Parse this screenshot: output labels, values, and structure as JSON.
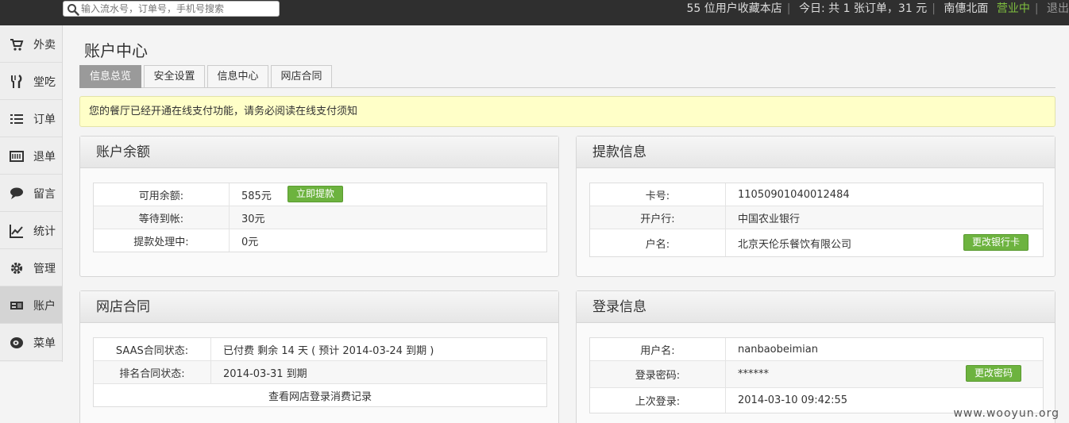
{
  "topbar": {
    "search_placeholder": "输入流水号，订单号，手机号搜索",
    "favorites": "55 位用户收藏本店",
    "today": "今日: 共 1 张订单，31 元",
    "shop_name": "南僡北面",
    "status": "营业中",
    "logout": "退出",
    "status_color": "#7fbf3f"
  },
  "sidebar": {
    "items": [
      {
        "label": "外卖",
        "icon": "cart-icon"
      },
      {
        "label": "堂吃",
        "icon": "fork-knife-icon"
      },
      {
        "label": "订单",
        "icon": "list-icon"
      },
      {
        "label": "退单",
        "icon": "return-icon"
      },
      {
        "label": "留言",
        "icon": "chat-bubble-icon"
      },
      {
        "label": "统计",
        "icon": "line-chart-icon"
      },
      {
        "label": "管理",
        "icon": "gear-icon"
      },
      {
        "label": "账户",
        "icon": "account-card-icon"
      },
      {
        "label": "菜单",
        "icon": "dish-icon"
      }
    ],
    "active_index": 7
  },
  "page": {
    "title": "账户中心",
    "tabs": [
      "信息总览",
      "安全设置",
      "信息中心",
      "网店合同"
    ],
    "active_tab": 0,
    "notice": "您的餐厅已经开通在线支付功能，请务必阅读在线支付须知"
  },
  "balance": {
    "title": "账户余额",
    "rows": [
      {
        "label": "可用余额:",
        "value": "585元"
      },
      {
        "label": "等待到帐:",
        "value": "30元"
      },
      {
        "label": "提款处理中:",
        "value": "0元"
      }
    ],
    "withdraw_button": "立即提款"
  },
  "withdraw_info": {
    "title": "提款信息",
    "rows": [
      {
        "label": "卡号:",
        "value": "11050901040012484"
      },
      {
        "label": "开户行:",
        "value": "中国农业银行"
      },
      {
        "label": "户名:",
        "value": "北京天伦乐餐饮有限公司"
      }
    ],
    "change_card_button": "更改银行卡"
  },
  "contract": {
    "title": "网店合同",
    "rows": [
      {
        "label": "SAAS合同状态:",
        "value": "已付费 剩余 14 天 ( 预计 2014-03-24 到期 )"
      },
      {
        "label": "排名合同状态:",
        "value": "2014-03-31 到期"
      }
    ],
    "link": "查看网店登录消费记录"
  },
  "login_info": {
    "title": "登录信息",
    "rows": [
      {
        "label": "用户名:",
        "value": "nanbaobeimian"
      },
      {
        "label": "登录密码:",
        "value": "******"
      },
      {
        "label": "上次登录:",
        "value": "2014-03-10 09:42:55"
      }
    ],
    "change_password_button": "更改密码"
  },
  "watermark": "www.wooyun.org"
}
